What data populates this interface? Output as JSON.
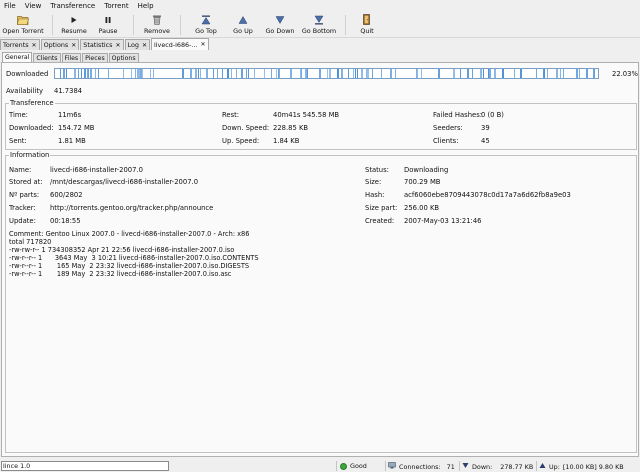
{
  "menu": [
    "File",
    "View",
    "Transference",
    "Torrent",
    "Help"
  ],
  "toolbar": {
    "open": "Open Torrent",
    "resume": "Resume",
    "pause": "Pause",
    "remove": "Remove",
    "go_top": "Go Top",
    "go_up": "Go Up",
    "go_down": "Go Down",
    "go_bottom": "Go Bottom",
    "quit": "Quit"
  },
  "main_tabs": [
    {
      "label": "Torrents"
    },
    {
      "label": "Options"
    },
    {
      "label": "Statistics"
    },
    {
      "label": "Log"
    },
    {
      "label": "livecd-i686-..."
    }
  ],
  "sub_tabs": [
    "General",
    "Clients",
    "Files",
    "Pieces",
    "Options"
  ],
  "general": {
    "downloaded_label": "Downloaded",
    "progress_fraction": 0.2203,
    "progress_text": "22.03%",
    "availability_label": "Availability",
    "availability_value": "41.7384"
  },
  "transference": {
    "title": "Transference",
    "time_label": "Time:",
    "time_value": "11m6s",
    "downloaded_label": "Downloaded:",
    "downloaded_value": "154.72 MB",
    "sent_label": "Sent:",
    "sent_value": "1.81 MB",
    "rest_label": "Rest:",
    "rest_value": "40m41s 545.58 MB",
    "down_speed_label": "Down. Speed:",
    "down_speed_value": "228.85 KB",
    "up_speed_label": "Up. Speed:",
    "up_speed_value": "1.84 KB",
    "failed_label": "Failed Hashes:",
    "failed_value": "0 (0 B)",
    "seeders_label": "Seeders:",
    "seeders_value": "39",
    "clients_label": "Clients:",
    "clients_value": "45"
  },
  "information": {
    "title": "Information",
    "name_label": "Name:",
    "name_value": "livecd-i686-installer-2007.0",
    "stored_label": "Stored at:",
    "stored_value": "/mnt/descargas/livecd-i686-installer-2007.0",
    "parts_label": "Nº parts:",
    "parts_value": "600/2802",
    "tracker_label": "Tracker:",
    "tracker_value": "http://torrents.gentoo.org/tracker.php/announce",
    "update_label": "Update:",
    "update_value": "00:18:55",
    "status_label": "Status:",
    "status_value": "Downloading",
    "size_label": "Size:",
    "size_value": "700.29 MB",
    "hash_label": "Hash:",
    "hash_value": "acf6060ebe8709443078c0d17a7a6d62fb8a9e03",
    "size_part_label": "Size part:",
    "size_part_value": "256.00 KB",
    "created_label": "Created:",
    "created_value": "2007-May-03 13:21:46",
    "comment_lines": [
      "Comment: Gentoo Linux 2007.0 - livecd-i686-installer-2007.0 - Arch: x86",
      "total 717820",
      "-rw-rw-r-- 1 734308352 Apr 21 22:56 livecd-i686-installer-2007.0.iso",
      "-rw-r--r-- 1      3643 May  3 10:21 livecd-i686-installer-2007.0.iso.CONTENTS",
      "-rw-r--r-- 1       165 May  2 23:32 livecd-i686-installer-2007.0.iso.DIGESTS",
      "-rw-r--r-- 1       189 May  2 23:32 livecd-i686-installer-2007.0.iso.asc"
    ]
  },
  "statusbar": {
    "input_value": "lince 1.0",
    "status": "Good",
    "connections_label": "Connections:",
    "connections_value": "71",
    "down_label": "Down:",
    "down_value": "278.77 KB",
    "up_label": "Up:",
    "up_value": "[10.00 KB] 9.80 KB"
  },
  "colors": {
    "progress": "#4a8fd8",
    "good": "#3aa83a"
  }
}
